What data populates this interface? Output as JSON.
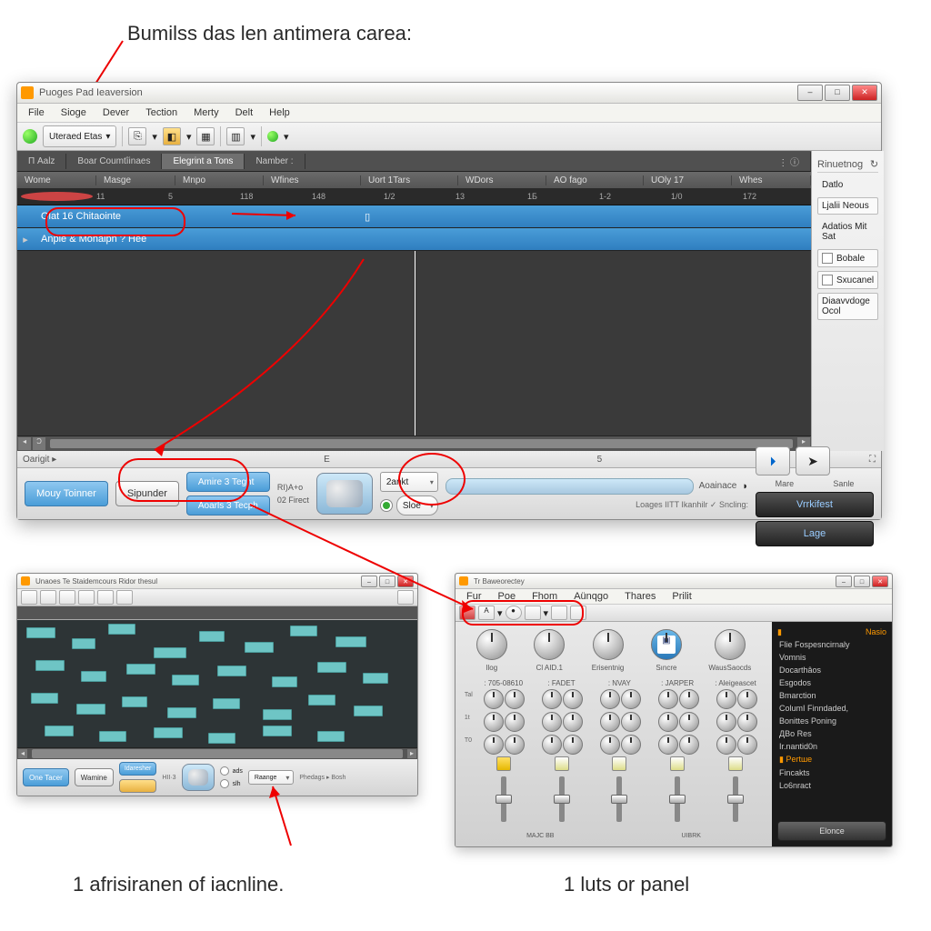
{
  "annotations": {
    "top": "Bumilss das len antimera carea:",
    "bottom_left": "1 afrisiranen of iacnline.",
    "bottom_right": "1 luts or panel"
  },
  "main": {
    "title": "Puoges Pad Ieaversion",
    "menu": [
      "File",
      "Sioge",
      "Dever",
      "Tection",
      "Merty",
      "Delt",
      "Help"
    ],
    "toolbar": {
      "first_label": "Uteraed Etas"
    },
    "tabs": [
      "П Aalz",
      "Boar Coumtîinaes",
      "Elegrint a Tons",
      "Namber  :"
    ],
    "cols": [
      "Wome",
      "Masge",
      "Mnpo",
      "Wfines",
      "Uort 1Tars",
      "WDors",
      "AO fago",
      "UOly 17",
      "Whes"
    ],
    "ruler": [
      "11",
      "5",
      "118",
      "148",
      "1/2",
      "13",
      "1Б",
      "1-2",
      "1/0",
      "172"
    ],
    "tracks": [
      {
        "name": "Olat 16 Chitaointe"
      },
      {
        "name": "Anple & Monaipn ? Hee"
      }
    ],
    "status_left": "Oarigit ▸",
    "status_mid": "E",
    "status_right": "5",
    "transport": {
      "btn1": "Mouy Toinner",
      "btn2": "Sipunder",
      "stack1": "Amire 3 Teght",
      "stack2": "Aoarls 3 Tecph",
      "label1": "RI)A+o",
      "label2": "02 Firect",
      "dd1": "2ankt",
      "slider_label": "Aoainace",
      "radio_label": "Sloe",
      "footer": "Loages IITT Ikanhilr  ✓  Sncling:"
    },
    "side": {
      "header": "Rinuetnog",
      "sub": "Datlo",
      "items": [
        "Ljalii Neous",
        "Adatios Mit Sat",
        "Bobale",
        "Sxucanel",
        "Diaavvdoge Ocol"
      ],
      "btn_more": "Mare",
      "btn_save": "Sanle",
      "btn_dark": "Vrrkifest",
      "btn_large": "Lage"
    }
  },
  "small_left": {
    "title": "Unaoes Te Staidemcours Ridor thesul",
    "transport": {
      "b1": "One Tacer",
      "b2": "Wamine",
      "b3": "Idaresher",
      "dd": "Raange",
      "lbl": "HII·3",
      "r1": "ads",
      "r2": "slh",
      "foot": "Phedags ▸ Bosh"
    }
  },
  "small_right": {
    "title": "Tr Baweorectey",
    "menu": [
      "Fur",
      "Poe",
      "Fhom",
      "Aünqgo",
      "Thares",
      "Prilit"
    ],
    "knob_labels": [
      "Ilog",
      "Cl AID.1",
      "Erisentnig",
      "Sıncre",
      "WausSaocds"
    ],
    "chan_top": [
      ": 705-08610",
      ": FADET",
      ": NVAY",
      ": JARPER",
      ": Aleigeascet"
    ],
    "chan_side": [
      "Tal",
      "1t",
      "T0"
    ],
    "chan_bottom": [
      "MAJС BB",
      "UIBRK"
    ],
    "side": {
      "header": "Nasio",
      "items": [
        "Flie Fospesncirnaly",
        "Vomnis",
        "Docarthâos",
        "Esgodos",
        "Bmarction",
        "ColumI Finndaded,",
        "Bonittes Poning",
        "ДВо Res",
        "Ir.nantid0n",
        "Pertше",
        "Fincakts",
        "Lo6nract"
      ],
      "btn": "Elonce"
    }
  }
}
